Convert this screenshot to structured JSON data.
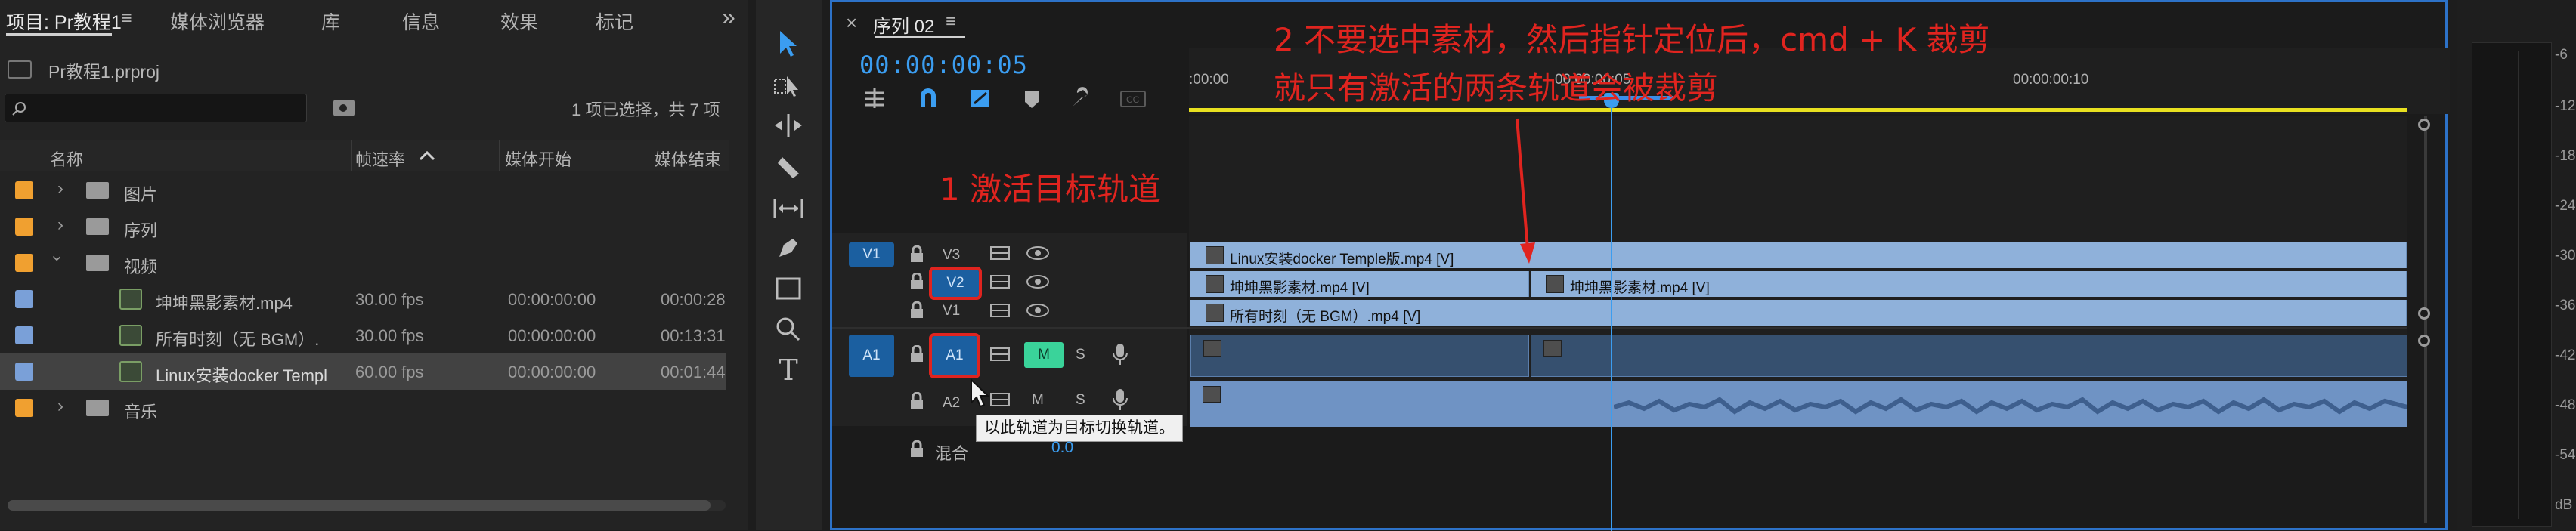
{
  "project": {
    "tabs": [
      {
        "label": "项目: Pr教程1"
      },
      {
        "label": "媒体浏览器"
      },
      {
        "label": "库"
      },
      {
        "label": "信息"
      },
      {
        "label": "效果"
      },
      {
        "label": "标记"
      }
    ],
    "menu_glyph": "≡",
    "overflow_glyph": "»",
    "file_name": "Pr教程1.prproj",
    "search_placeholder": "",
    "selection_info": "1 项已选择，共 7 项",
    "columns": {
      "name": "名称",
      "fps": "帧速率",
      "start": "媒体开始",
      "end": "媒体结束"
    },
    "rows": [
      {
        "name": "图片",
        "type": "folder",
        "fps": "",
        "start": "",
        "end": "",
        "expanded": false,
        "color": "#f0a030"
      },
      {
        "name": "序列",
        "type": "folder",
        "fps": "",
        "start": "",
        "end": "",
        "expanded": false,
        "color": "#f0a030"
      },
      {
        "name": "视频",
        "type": "folder",
        "fps": "",
        "start": "",
        "end": "",
        "expanded": true,
        "color": "#f0a030"
      },
      {
        "name": "坤坤黑影素材.mp4",
        "type": "clip",
        "fps": "30.00 fps",
        "start": "00:00:00:00",
        "end": "00:00:28",
        "color": "#7aa0d8"
      },
      {
        "name": "所有时刻（无 BGM）.",
        "type": "clip",
        "fps": "30.00 fps",
        "start": "00:00:00:00",
        "end": "00:13:31",
        "color": "#7aa0d8"
      },
      {
        "name": "Linux安装docker Templ",
        "type": "clip",
        "fps": "60.00 fps",
        "start": "00:00:00:00",
        "end": "00:01:44",
        "selected": true,
        "color": "#7aa0d8"
      },
      {
        "name": "音乐",
        "type": "folder",
        "fps": "",
        "start": "",
        "end": "",
        "expanded": false,
        "color": "#f0a030"
      }
    ]
  },
  "tools": [
    "selection-tool",
    "track-select-tool",
    "ripple-edit-tool",
    "razor-tool",
    "slip-tool",
    "pen-tool",
    "rectangle-tool",
    "hand-tool",
    "type-tool"
  ],
  "timeline": {
    "close_glyph": "×",
    "sequence_name": "序列 02",
    "menu_glyph": "≡",
    "timecode": "00:00:00:05",
    "ruler_labels": [
      ":00:00",
      "00:00:00:05",
      "00:00:00:10"
    ],
    "tracks": {
      "v1_source": "V1",
      "v3": "V3",
      "v2": "V2",
      "v1": "V1",
      "a1_source": "A1",
      "a1": "A1",
      "a2": "A2",
      "mute": "M",
      "solo": "S",
      "mix_label": "混合",
      "mix_value": "0.0"
    },
    "clips": {
      "v3_clip": "Linux安装docker Temple版.mp4 [V]",
      "v2_clip_a": "坤坤黑影素材.mp4 [V]",
      "v2_clip_b": "坤坤黑影素材.mp4 [V]",
      "v1_clip": "所有时刻（无 BGM）.mp4 [V]"
    },
    "tooltip": "以此轨道为目标切换轨道。"
  },
  "annotations": {
    "note1": "1 激活目标轨道",
    "note2_line1": "2 不要选中素材，然后指针定位后，cmd + K 裁剪",
    "note2_line2": "就只有激活的两条轨道会被裁剪"
  },
  "meter": {
    "labels": [
      "-6",
      "-12",
      "-18",
      "-24",
      "-30",
      "-36",
      "-42",
      "-48",
      "-54",
      "dB"
    ]
  },
  "colors": {
    "accent_blue": "#2d72c8",
    "timecode_blue": "#3b9df0",
    "clip_video": "#8fb1da",
    "clip_audio": "#6f93c4",
    "annotation_red": "#e0241f",
    "mute_green": "#3ad39a",
    "work_area_yellow": "#e8e020"
  }
}
